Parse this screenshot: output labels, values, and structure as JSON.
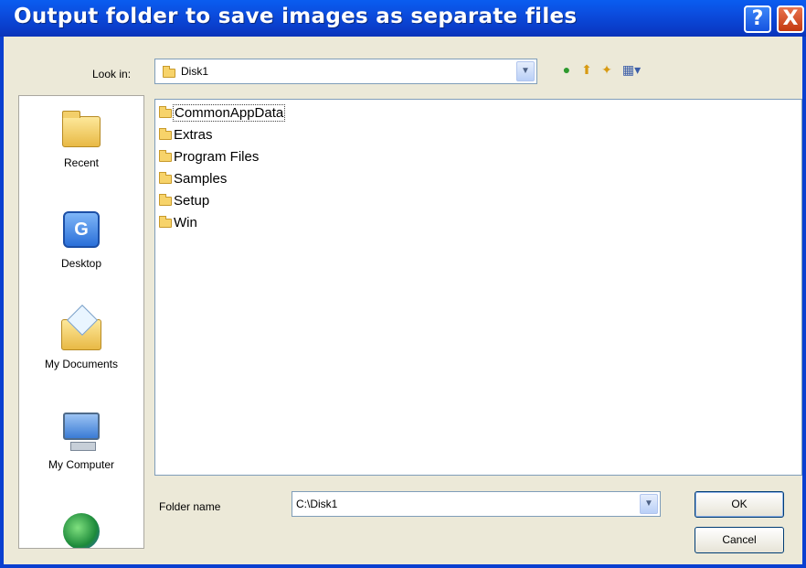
{
  "window": {
    "title": "Output folder to save images as separate files",
    "help_glyph": "?",
    "close_glyph": "X"
  },
  "lookin": {
    "label": "Look in:",
    "value": "Disk1"
  },
  "toolbar": {
    "back_icon": "green-back-arrow-icon",
    "up_icon": "up-one-level-icon",
    "new_folder_icon": "new-folder-icon",
    "views_icon": "views-menu-icon",
    "back_glyph": "●",
    "up_glyph": "⬆",
    "new_glyph": "✦",
    "views_glyph": "▦▾"
  },
  "places": [
    {
      "label": "Recent",
      "icon": "recent-folder-icon"
    },
    {
      "label": "Desktop",
      "icon": "desktop-icon"
    },
    {
      "label": "My Documents",
      "icon": "my-documents-icon"
    },
    {
      "label": "My Computer",
      "icon": "my-computer-icon"
    },
    {
      "label": "",
      "icon": "network-icon"
    }
  ],
  "files": [
    {
      "name": "CommonAppData",
      "selected": true
    },
    {
      "name": "Extras"
    },
    {
      "name": "Program Files"
    },
    {
      "name": "Samples"
    },
    {
      "name": "Setup"
    },
    {
      "name": "Win"
    }
  ],
  "folder_name": {
    "label": "Folder name",
    "value": "C:\\Disk1"
  },
  "buttons": {
    "ok": "OK",
    "cancel": "Cancel"
  },
  "colors": {
    "titlebar": "#0b4ee0",
    "dialog_face": "#ece9d8",
    "close": "#c3380f"
  }
}
